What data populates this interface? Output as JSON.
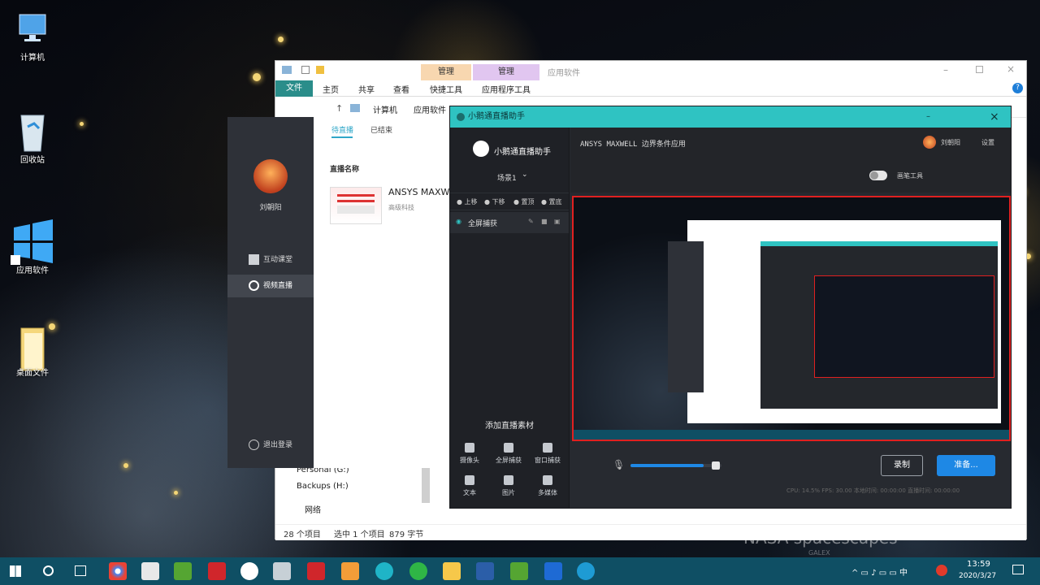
{
  "desktop": {
    "icons": [
      {
        "name": "computer-icon",
        "label": "计算机"
      },
      {
        "name": "recycle-bin-icon",
        "label": "回收站"
      },
      {
        "name": "app-shortcut-icon",
        "label": "应用软件"
      },
      {
        "name": "folder-icon",
        "label": "桌面文件"
      }
    ],
    "watermark": "NASA spacescapes",
    "watermark_sub": "GALEX"
  },
  "explorer": {
    "title": "应用软件",
    "context_tabs": [
      "管理",
      "管理"
    ],
    "ribbon_tabs": [
      "文件",
      "主页",
      "共享",
      "查看",
      "快捷工具",
      "应用程序工具"
    ],
    "breadcrumb": [
      "计算机",
      "应用软件"
    ],
    "tree_items": [
      "Personal (G:)",
      "Backups (H:)",
      "网络"
    ],
    "status_count": "28 个项目",
    "status_selected": "选中 1 个项目",
    "status_size": "879 字节"
  },
  "classroom": {
    "user_name": "刘朝阳",
    "nav": [
      "互动课堂",
      "视频直播"
    ],
    "logout": "退出登录",
    "tabs": [
      "待直播",
      "已结束"
    ],
    "section_title": "直播名称",
    "live_title": "ANSYS MAXW",
    "live_subtitle": "高级科技"
  },
  "assistant": {
    "window_title": "小鹅通直播助手",
    "brand": "小鹅通直播助手",
    "scene": "场景1",
    "layer_actions": [
      "上移",
      "下移",
      "置顶",
      "置底"
    ],
    "source": "全屏捕获",
    "add_material": "添加直播素材",
    "tools": [
      "摄像头",
      "全屏捕获",
      "窗口捕获",
      "文本",
      "图片",
      "多媒体"
    ],
    "stream_title": "ANSYS MAXWELL 边界条件应用",
    "user_name": "刘朝阳",
    "settings": "设置",
    "beauty_tool": "画笔工具",
    "volume": 0.8,
    "record_button": "录制",
    "start_button": "准备...",
    "stats": "CPU: 14.5%  FPS: 30.00  本地时间: 00:00:00  直播时间: 00:00:00"
  },
  "taskbar": {
    "time": "13:59",
    "date": "2020/3/27"
  },
  "colors": {
    "accent": "#2fc3c2",
    "primary_blue": "#1e88e5",
    "record_red": "#e02020",
    "taskbar": "#0f4f64"
  }
}
